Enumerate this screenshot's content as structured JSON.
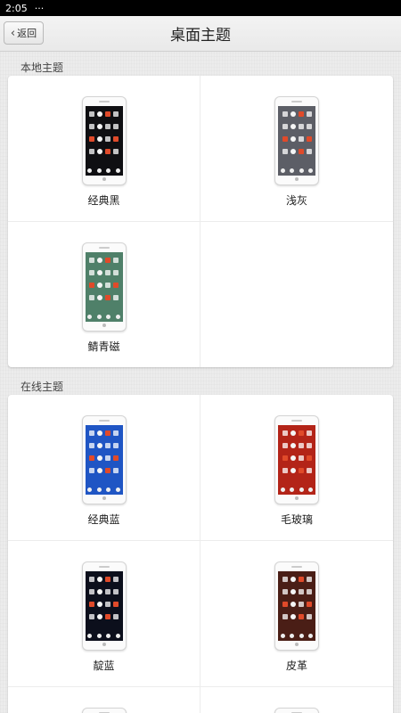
{
  "statusbar": {
    "time": "2:05",
    "more": "···"
  },
  "header": {
    "back_label": "返回",
    "title": "桌面主题"
  },
  "sections": [
    {
      "label": "本地主题",
      "themes": [
        {
          "name": "经典黑",
          "bg": "#0f0f12"
        },
        {
          "name": "浅灰",
          "bg": "#5c5e66"
        },
        {
          "name": "鲭青磁",
          "bg": "#4f8069"
        }
      ]
    },
    {
      "label": "在线主题",
      "themes": [
        {
          "name": "经典蓝",
          "bg": "#1f55c4"
        },
        {
          "name": "毛玻璃",
          "bg": "#b32418"
        },
        {
          "name": "靛蓝",
          "bg": "#0c0f1c"
        },
        {
          "name": "皮革",
          "bg": "#4a1e16"
        }
      ]
    }
  ]
}
